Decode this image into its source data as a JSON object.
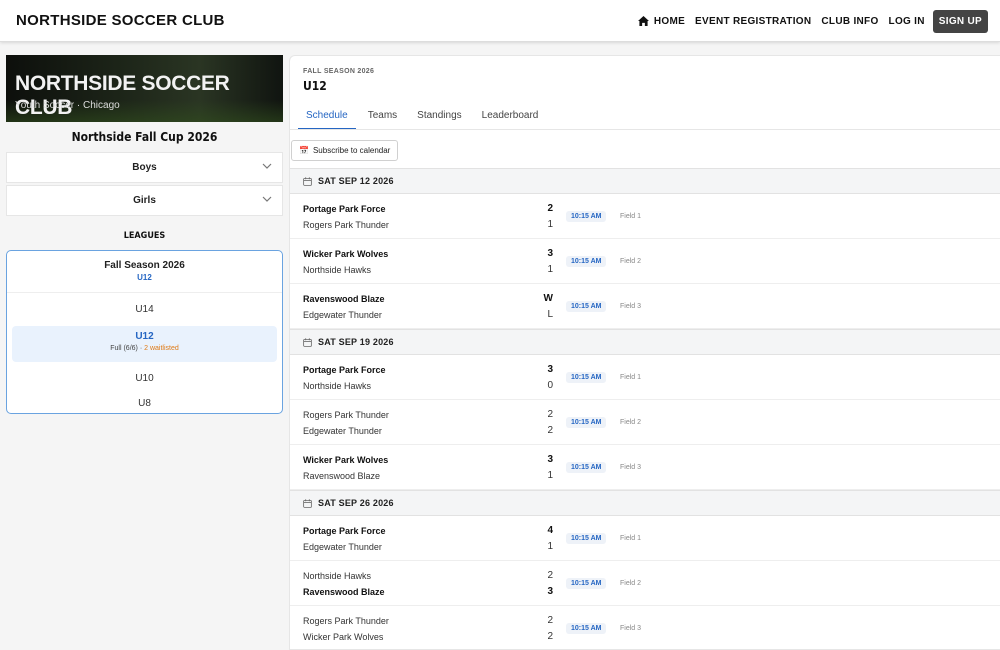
{
  "header": {
    "brand": "NORTHSIDE SOCCER CLUB",
    "nav": {
      "home": "HOME",
      "event_registration": "EVENT REGISTRATION",
      "club_info": "CLUB INFO",
      "log_in": "LOG IN",
      "sign_up": "SIGN UP"
    }
  },
  "sidebar": {
    "banner_title": "NORTHSIDE SOCCER CLUB",
    "banner_subtitle": "Youth Soccer · Chicago",
    "cup_title": "Northside Fall Cup 2026",
    "divisions": [
      "Boys",
      "Girls"
    ],
    "leagues_title": "LEAGUES",
    "league": {
      "title": "Fall Season 2026",
      "selected": "U12",
      "items_before": [
        "U14"
      ],
      "active": {
        "label": "U12",
        "status": "Full (6/6)",
        "separator": " · ",
        "waitlist": "2 waitlisted"
      },
      "items_after": [
        "U10",
        "U8"
      ]
    }
  },
  "main": {
    "season_label": "FALL SEASON 2026",
    "age_group": "U12",
    "tabs": [
      "Schedule",
      "Teams",
      "Standings",
      "Leaderboard"
    ],
    "active_tab": "Schedule",
    "subscribe_icon": "📅",
    "subscribe_label": "Subscribe to calendar",
    "days": [
      {
        "date": "SAT SEP 12 2026",
        "matches": [
          {
            "home": "Portage Park Force",
            "away": "Rogers Park Thunder",
            "home_score": "2",
            "away_score": "1",
            "winner": "home",
            "time": "10:15 AM",
            "field": "Field 1"
          },
          {
            "home": "Wicker Park Wolves",
            "away": "Northside Hawks",
            "home_score": "3",
            "away_score": "1",
            "winner": "home",
            "time": "10:15 AM",
            "field": "Field 2"
          },
          {
            "home": "Ravenswood Blaze",
            "away": "Edgewater Thunder",
            "home_score": "W",
            "away_score": "L",
            "winner": "home",
            "time": "10:15 AM",
            "field": "Field 3"
          }
        ]
      },
      {
        "date": "SAT SEP 19 2026",
        "matches": [
          {
            "home": "Portage Park Force",
            "away": "Northside Hawks",
            "home_score": "3",
            "away_score": "0",
            "winner": "home",
            "time": "10:15 AM",
            "field": "Field 1"
          },
          {
            "home": "Rogers Park Thunder",
            "away": "Edgewater Thunder",
            "home_score": "2",
            "away_score": "2",
            "winner": "none",
            "time": "10:15 AM",
            "field": "Field 2"
          },
          {
            "home": "Wicker Park Wolves",
            "away": "Ravenswood Blaze",
            "home_score": "3",
            "away_score": "1",
            "winner": "home",
            "time": "10:15 AM",
            "field": "Field 3"
          }
        ]
      },
      {
        "date": "SAT SEP 26 2026",
        "matches": [
          {
            "home": "Portage Park Force",
            "away": "Edgewater Thunder",
            "home_score": "4",
            "away_score": "1",
            "winner": "home",
            "time": "10:15 AM",
            "field": "Field 1"
          },
          {
            "home": "Northside Hawks",
            "away": "Ravenswood Blaze",
            "home_score": "2",
            "away_score": "3",
            "winner": "away",
            "time": "10:15 AM",
            "field": "Field 2"
          },
          {
            "home": "Rogers Park Thunder",
            "away": "Wicker Park Wolves",
            "home_score": "2",
            "away_score": "2",
            "winner": "none",
            "time": "10:15 AM",
            "field": "Field 3"
          }
        ]
      }
    ]
  },
  "colors": {
    "accent": "#2566c3",
    "waitlist": "#e07b16",
    "signup_bg": "#444444"
  }
}
